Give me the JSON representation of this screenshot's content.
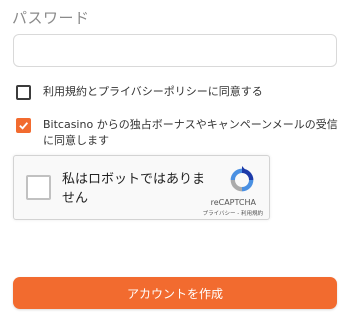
{
  "form": {
    "password_label": "パスワード",
    "password_value": "",
    "terms": {
      "label": "利用規約とプライバシーポリシーに同意する",
      "checked": false
    },
    "promo": {
      "label": "Bitcasino からの独占ボーナスやキャンペーンメールの受信に同意します",
      "checked": true
    },
    "recaptcha": {
      "label": "私はロボットではありません",
      "brand": "reCAPTCHA",
      "links": "プライバシー - 利用規約",
      "icon": "recaptcha-logo-icon"
    },
    "submit_label": "アカウントを作成"
  },
  "colors": {
    "accent": "#f26b2f",
    "input_border": "#d9d9d9",
    "label_gray": "#8a8a8a"
  }
}
